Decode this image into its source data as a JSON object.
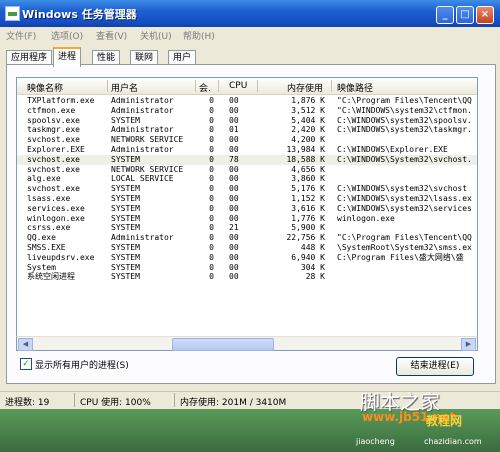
{
  "window": {
    "title": "Windows 任务管理器",
    "minimize": "_",
    "maximize": "□",
    "close": "×"
  },
  "menu": [
    "文件(F)",
    "选项(O)",
    "查看(V)",
    "关机(U)",
    "帮助(H)"
  ],
  "tabs": [
    {
      "label": "应用程序",
      "active": false
    },
    {
      "label": "进程",
      "active": true
    },
    {
      "label": "性能",
      "active": false
    },
    {
      "label": "联网",
      "active": false
    },
    {
      "label": "用户",
      "active": false
    }
  ],
  "columns": {
    "name": "映像名称",
    "user": "用户名",
    "session": "会.",
    "cpu": "CPU",
    "mem": "内存使用",
    "path": "映像路径"
  },
  "processes": [
    {
      "name": "TXPlatform.exe",
      "user": "Administrator",
      "session": "0",
      "cpu": "00",
      "mem": "1,876 K",
      "path": "\"C:\\Program Files\\Tencent\\QQ"
    },
    {
      "name": "ctfmon.exe",
      "user": "Administrator",
      "session": "0",
      "cpu": "00",
      "mem": "3,512 K",
      "path": "\"C:\\WINDOWS\\system32\\ctfmon."
    },
    {
      "name": "spoolsv.exe",
      "user": "SYSTEM",
      "session": "0",
      "cpu": "00",
      "mem": "5,404 K",
      "path": "C:\\WINDOWS\\system32\\spoolsv."
    },
    {
      "name": "taskmgr.exe",
      "user": "Administrator",
      "session": "0",
      "cpu": "01",
      "mem": "2,420 K",
      "path": "C:\\WINDOWS\\system32\\taskmgr."
    },
    {
      "name": "svchost.exe",
      "user": "NETWORK SERVICE",
      "session": "0",
      "cpu": "00",
      "mem": "4,200 K",
      "path": ""
    },
    {
      "name": "Explorer.EXE",
      "user": "Administrator",
      "session": "0",
      "cpu": "00",
      "mem": "13,984 K",
      "path": "C:\\WINDOWS\\Explorer.EXE"
    },
    {
      "name": "svchost.exe",
      "user": "SYSTEM",
      "session": "0",
      "cpu": "78",
      "mem": "18,588 K",
      "path": "C:\\WINDOWS\\System32\\svchost."
    },
    {
      "name": "svchost.exe",
      "user": "NETWORK SERVICE",
      "session": "0",
      "cpu": "00",
      "mem": "4,656 K",
      "path": ""
    },
    {
      "name": "alg.exe",
      "user": "LOCAL SERVICE",
      "session": "0",
      "cpu": "00",
      "mem": "3,860 K",
      "path": ""
    },
    {
      "name": "svchost.exe",
      "user": "SYSTEM",
      "session": "0",
      "cpu": "00",
      "mem": "5,176 K",
      "path": "C:\\WINDOWS\\system32\\svchost"
    },
    {
      "name": "lsass.exe",
      "user": "SYSTEM",
      "session": "0",
      "cpu": "00",
      "mem": "1,152 K",
      "path": "C:\\WINDOWS\\system32\\lsass.ex"
    },
    {
      "name": "services.exe",
      "user": "SYSTEM",
      "session": "0",
      "cpu": "00",
      "mem": "3,616 K",
      "path": "C:\\WINDOWS\\system32\\services"
    },
    {
      "name": "winlogon.exe",
      "user": "SYSTEM",
      "session": "0",
      "cpu": "00",
      "mem": "1,776 K",
      "path": "winlogon.exe"
    },
    {
      "name": "csrss.exe",
      "user": "SYSTEM",
      "session": "0",
      "cpu": "21",
      "mem": "5,900 K",
      "path": ""
    },
    {
      "name": "QQ.exe",
      "user": "Administrator",
      "session": "0",
      "cpu": "00",
      "mem": "22,756 K",
      "path": "\"C:\\Program Files\\Tencent\\QQ"
    },
    {
      "name": "SMSS.EXE",
      "user": "SYSTEM",
      "session": "0",
      "cpu": "00",
      "mem": "448 K",
      "path": "\\SystemRoot\\System32\\smss.ex"
    },
    {
      "name": "liveupdsrv.exe",
      "user": "SYSTEM",
      "session": "0",
      "cpu": "00",
      "mem": "6,940 K",
      "path": "C:\\Program Files\\盛大网络\\盛"
    },
    {
      "name": "System",
      "user": "SYSTEM",
      "session": "0",
      "cpu": "00",
      "mem": "304 K",
      "path": ""
    },
    {
      "name": "系统空闲进程",
      "user": "SYSTEM",
      "session": "0",
      "cpu": "00",
      "mem": "28 K",
      "path": ""
    }
  ],
  "selected_row": 6,
  "show_all_users": {
    "label": "显示所有用户的进程(S)",
    "checked": true,
    "mark": "✓"
  },
  "end_process_button": "结束进程(E)",
  "scroll_left": "◀",
  "scroll_right": "▶",
  "status": {
    "processes": "进程数: 19",
    "cpu": "CPU 使用: 100%",
    "memory": "内存使用: 201M / 3410M"
  },
  "watermark": {
    "line1": "脚本之家",
    "line2a": "www.jb51.net",
    "line2b": "教程网",
    "line3a": "jiaocheng",
    "line3b": "chazidian.com"
  }
}
